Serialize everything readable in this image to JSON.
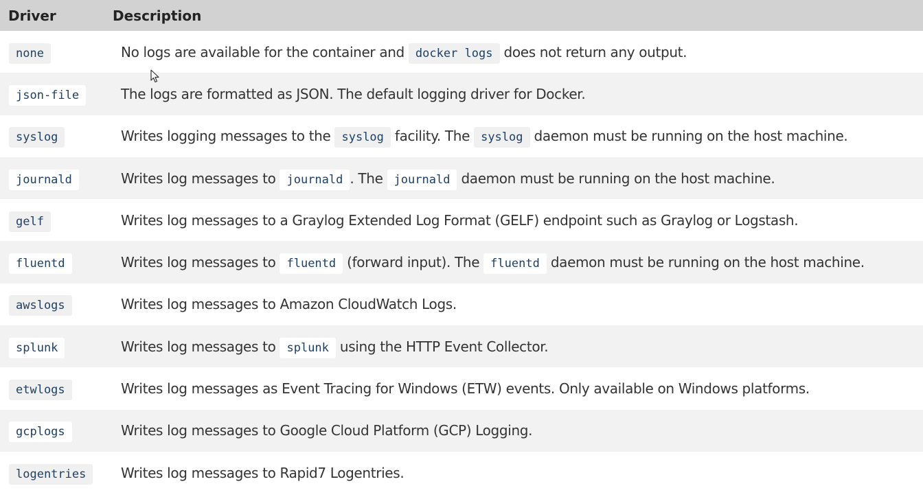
{
  "table": {
    "headers": {
      "driver": "Driver",
      "description": "Description"
    },
    "rows": [
      {
        "driver": "none",
        "segments": [
          "No logs are available for the container and ",
          {
            "code": "docker logs"
          },
          " does not return any output."
        ]
      },
      {
        "driver": "json-file",
        "segments": [
          "The logs are formatted as JSON. The default logging driver for Docker."
        ]
      },
      {
        "driver": "syslog",
        "segments": [
          "Writes logging messages to the ",
          {
            "code": "syslog"
          },
          " facility. The ",
          {
            "code": "syslog"
          },
          " daemon must be running on the host machine."
        ]
      },
      {
        "driver": "journald",
        "segments": [
          "Writes log messages to ",
          {
            "code": "journald"
          },
          ". The ",
          {
            "code": "journald"
          },
          " daemon must be running on the host machine."
        ]
      },
      {
        "driver": "gelf",
        "segments": [
          "Writes log messages to a Graylog Extended Log Format (GELF) endpoint such as Graylog or Logstash."
        ]
      },
      {
        "driver": "fluentd",
        "segments": [
          "Writes log messages to ",
          {
            "code": "fluentd"
          },
          " (forward input). The ",
          {
            "code": "fluentd"
          },
          " daemon must be running on the host machine."
        ]
      },
      {
        "driver": "awslogs",
        "segments": [
          "Writes log messages to Amazon CloudWatch Logs."
        ]
      },
      {
        "driver": "splunk",
        "segments": [
          "Writes log messages to ",
          {
            "code": "splunk"
          },
          " using the HTTP Event Collector."
        ]
      },
      {
        "driver": "etwlogs",
        "segments": [
          "Writes log messages as Event Tracing for Windows (ETW) events. Only available on Windows platforms."
        ]
      },
      {
        "driver": "gcplogs",
        "segments": [
          "Writes log messages to Google Cloud Platform (GCP) Logging."
        ]
      },
      {
        "driver": "logentries",
        "segments": [
          "Writes log messages to Rapid7 Logentries."
        ]
      }
    ]
  },
  "colors": {
    "header_bg": "#d2d2d2",
    "row_alt_bg": "#f2f2f2",
    "code_text": "#1e3f66"
  },
  "icons": {
    "cursor": "mouse-pointer-icon"
  }
}
